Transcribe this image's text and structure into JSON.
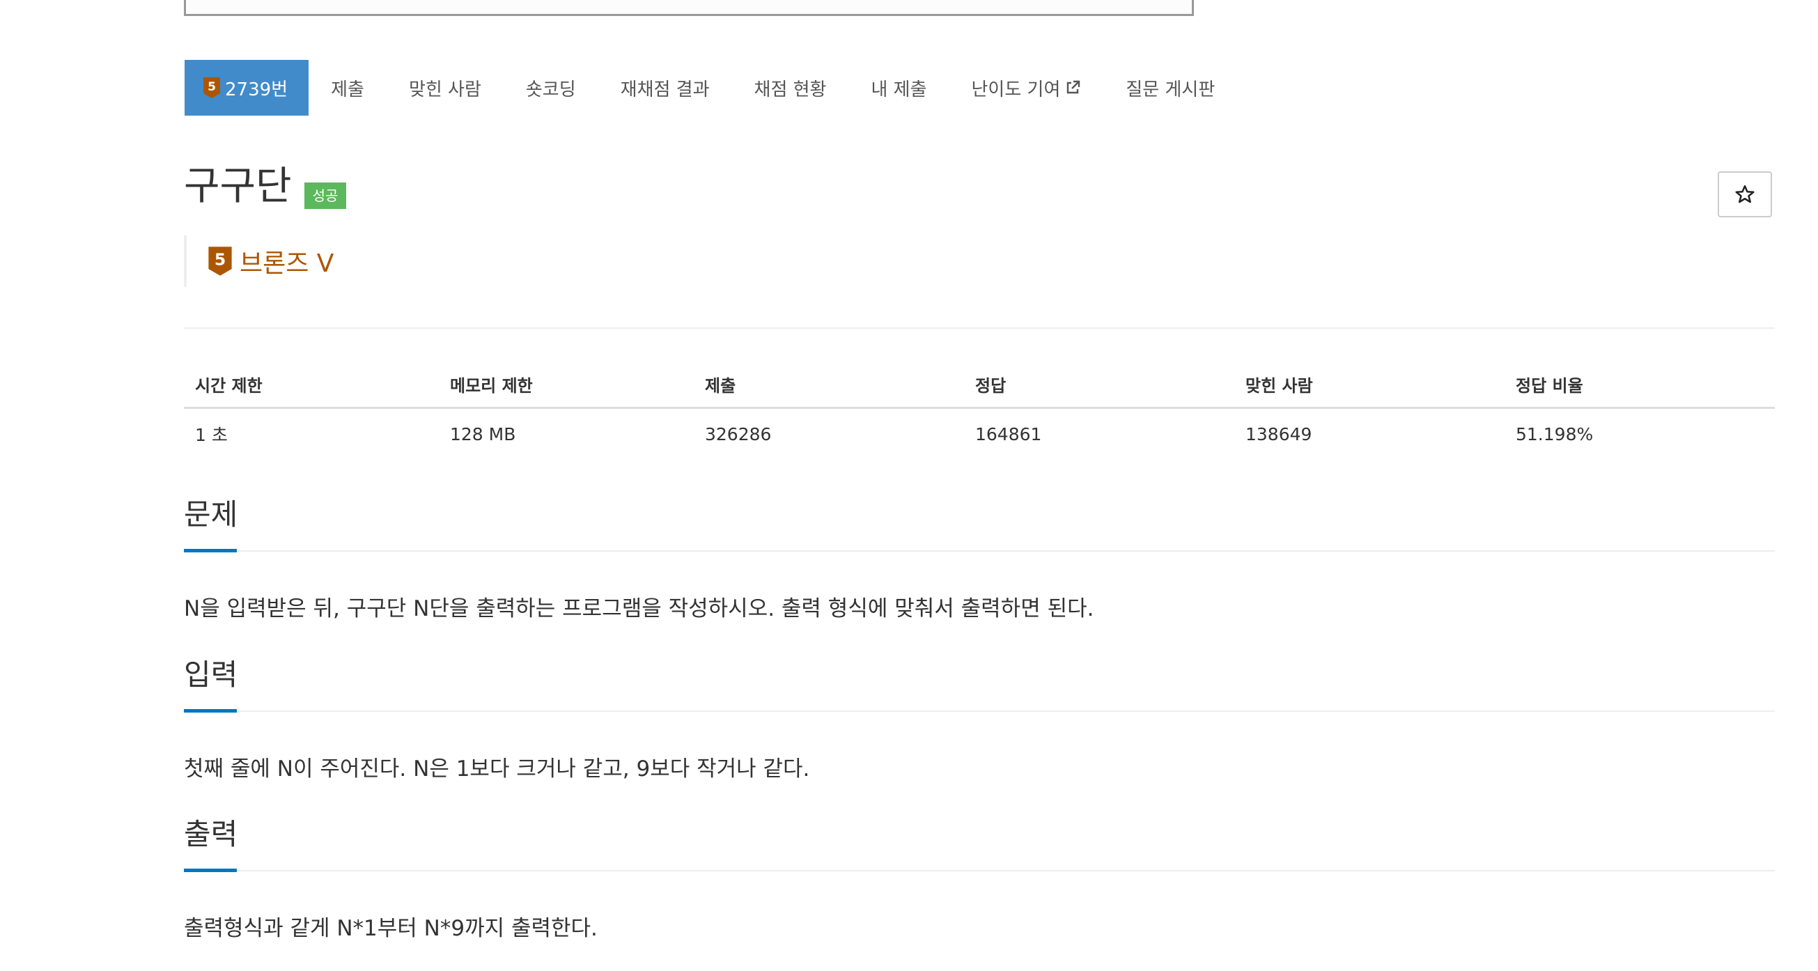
{
  "tabs": [
    {
      "label": "2739번",
      "tier_num": "5",
      "active": true
    },
    {
      "label": "제출"
    },
    {
      "label": "맞힌 사람"
    },
    {
      "label": "숏코딩"
    },
    {
      "label": "재채점 결과"
    },
    {
      "label": "채점 현황"
    },
    {
      "label": "내 제출"
    },
    {
      "label": "난이도 기여",
      "icon": "external-link-icon"
    },
    {
      "label": "질문 게시판"
    }
  ],
  "problem": {
    "title": "구구단",
    "badge": "성공",
    "tier": "브론즈 V",
    "tier_num": "5",
    "star_icon": "star-outline-icon"
  },
  "info_table": {
    "headers": [
      "시간 제한",
      "메모리 제한",
      "제출",
      "정답",
      "맞힌 사람",
      "정답 비율"
    ],
    "values": [
      "1 초",
      "128 MB",
      "326286",
      "164861",
      "138649",
      "51.198%"
    ]
  },
  "sections": [
    {
      "title": "문제",
      "text": "N을 입력받은 뒤, 구구단 N단을 출력하는 프로그램을 작성하시오. 출력 형식에 맞춰서 출력하면 된다."
    },
    {
      "title": "입력",
      "text": "첫째 줄에 N이 주어진다. N은 1보다 크거나 같고, 9보다 작거나 같다."
    },
    {
      "title": "출력",
      "text": "출력형식과 같게 N*1부터 N*9까지 출력한다."
    }
  ],
  "colors": {
    "tab_active": "#428bca",
    "badge_success": "#5cb85c",
    "bronze": "#ad5600",
    "section_accent": "#0076c0"
  }
}
